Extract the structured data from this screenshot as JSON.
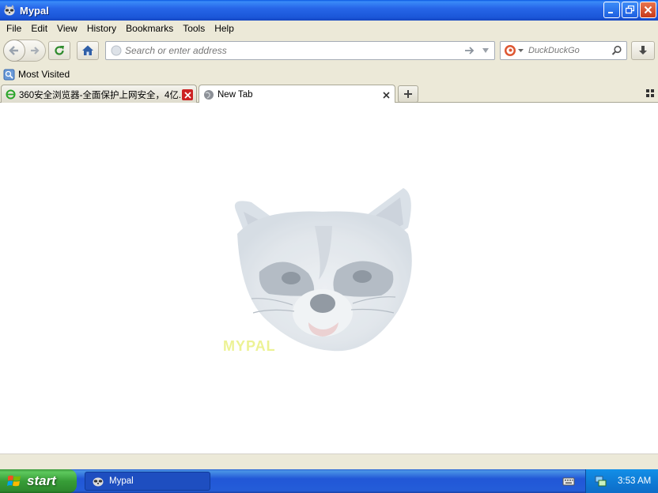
{
  "window": {
    "title": "Mypal"
  },
  "menu": [
    "File",
    "Edit",
    "View",
    "History",
    "Bookmarks",
    "Tools",
    "Help"
  ],
  "navbar": {
    "url_placeholder": "Search or enter address",
    "search_placeholder": "DuckDuckGo"
  },
  "bookmarks": {
    "most_visited": "Most Visited"
  },
  "tabs": [
    {
      "label": "360安全浏览器-全面保护上网安全，4亿...",
      "active": false
    },
    {
      "label": "New Tab",
      "active": true
    }
  ],
  "content": {
    "watermark_text": "MYPAL"
  },
  "taskbar": {
    "start_label": "start",
    "task_label": "Mypal",
    "clock": "3:53 AM"
  },
  "colors": {
    "titlebar": "#2766E8",
    "taskbar": "#245DD8",
    "start": "#379D37",
    "chrome": "#ECE9D8"
  }
}
